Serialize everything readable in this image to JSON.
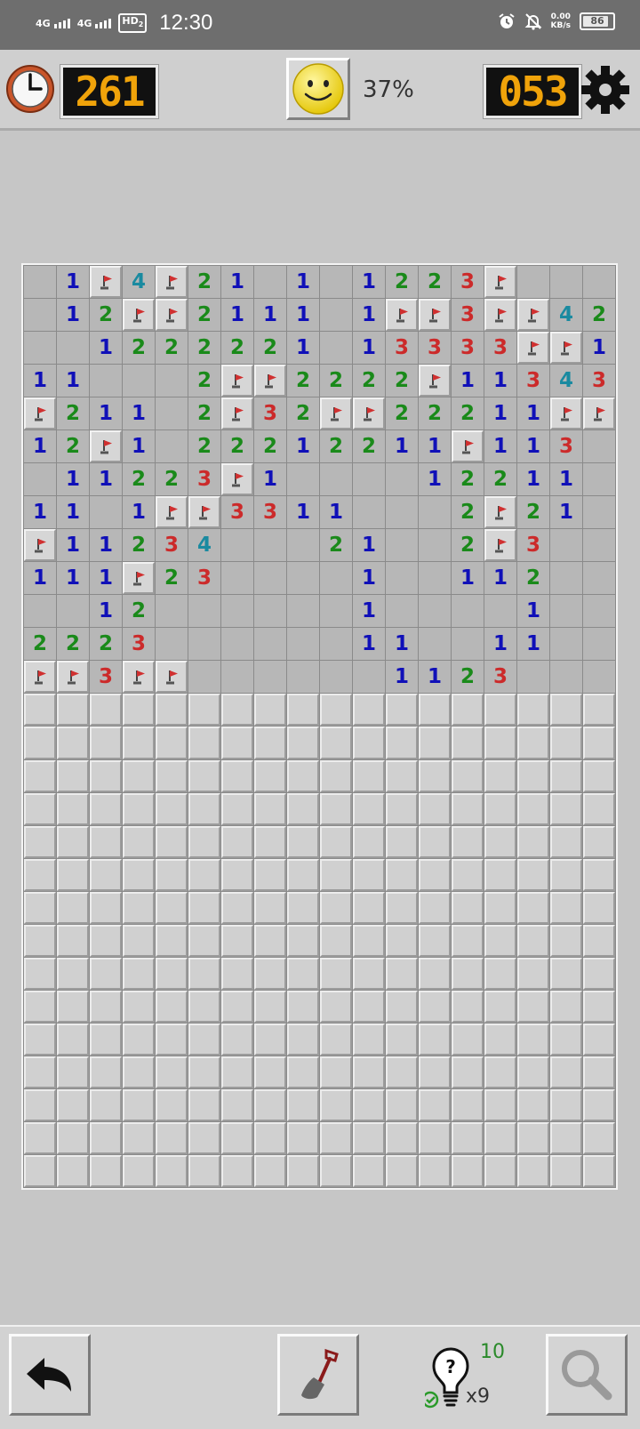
{
  "status_bar": {
    "time": "12:30",
    "network_1": "4G",
    "network_2": "4G",
    "hd_badge": "HD",
    "hd_sub": "2",
    "speed_value": "0.00",
    "speed_unit": "KB/s",
    "battery": "86"
  },
  "header": {
    "timer_value": "261",
    "progress_percent": "37%",
    "mines_left": "053",
    "lcd_color": "#f0a30a"
  },
  "icons": {
    "timer": "clock-icon",
    "face": "smiley-face-icon",
    "settings": "gear-icon",
    "undo": "undo-arrow-icon",
    "dig": "shovel-icon",
    "hint": "lightbulb-question-icon",
    "zoom": "magnifier-icon"
  },
  "board": {
    "cols": 18,
    "rows": 28,
    "legend": "0 = opened empty, F = flag, digits = mine count, H = unopened",
    "cells": [
      [
        "0",
        "1",
        "F",
        "4",
        "F",
        "2",
        "1",
        "0",
        "1",
        "0",
        "1",
        "2",
        "2",
        "3",
        "F",
        "0",
        "0",
        "0"
      ],
      [
        "0",
        "1",
        "2",
        "F",
        "F",
        "2",
        "1",
        "1",
        "1",
        "0",
        "1",
        "F",
        "F",
        "3",
        "F",
        "F",
        "4",
        "2"
      ],
      [
        "0",
        "0",
        "1",
        "2",
        "2",
        "2",
        "2",
        "2",
        "1",
        "0",
        "1",
        "3",
        "3",
        "3",
        "3",
        "F",
        "F",
        "1"
      ],
      [
        "1",
        "1",
        "0",
        "0",
        "0",
        "2",
        "F",
        "F",
        "2",
        "2",
        "2",
        "2",
        "F",
        "1",
        "1",
        "3",
        "4",
        "3"
      ],
      [
        "F",
        "2",
        "1",
        "1",
        "0",
        "2",
        "F",
        "3",
        "2",
        "F",
        "F",
        "2",
        "2",
        "2",
        "1",
        "1",
        "F",
        "F"
      ],
      [
        "1",
        "2",
        "F",
        "1",
        "0",
        "2",
        "2",
        "2",
        "1",
        "2",
        "2",
        "1",
        "1",
        "F",
        "1",
        "1",
        "3",
        "0"
      ],
      [
        "0",
        "1",
        "1",
        "2",
        "2",
        "3",
        "F",
        "1",
        "0",
        "0",
        "0",
        "0",
        "1",
        "2",
        "2",
        "1",
        "1",
        "0"
      ],
      [
        "1",
        "1",
        "0",
        "1",
        "F",
        "F",
        "3",
        "3",
        "1",
        "1",
        "0",
        "0",
        "0",
        "2",
        "F",
        "2",
        "1",
        "0"
      ],
      [
        "F",
        "1",
        "1",
        "2",
        "3",
        "4",
        "0",
        "0",
        "0",
        "2",
        "1",
        "0",
        "0",
        "2",
        "F",
        "3",
        "0",
        "0"
      ],
      [
        "1",
        "1",
        "1",
        "F",
        "2",
        "3",
        "0",
        "0",
        "0",
        "0",
        "1",
        "0",
        "0",
        "1",
        "1",
        "2",
        "0",
        "0"
      ],
      [
        "0",
        "0",
        "1",
        "2",
        "0",
        "0",
        "0",
        "0",
        "0",
        "0",
        "1",
        "0",
        "0",
        "0",
        "0",
        "1",
        "0",
        "0"
      ],
      [
        "2",
        "2",
        "2",
        "3",
        "0",
        "0",
        "0",
        "0",
        "0",
        "0",
        "1",
        "1",
        "0",
        "0",
        "1",
        "1",
        "0",
        "0"
      ],
      [
        "F",
        "F",
        "3",
        "F",
        "F",
        "0",
        "0",
        "0",
        "0",
        "0",
        "0",
        "1",
        "1",
        "2",
        "3",
        "0",
        "0",
        "0"
      ]
    ],
    "hidden_rows_after": 15
  },
  "footer": {
    "hint_count": "10",
    "hint_multiplier": "x9"
  }
}
